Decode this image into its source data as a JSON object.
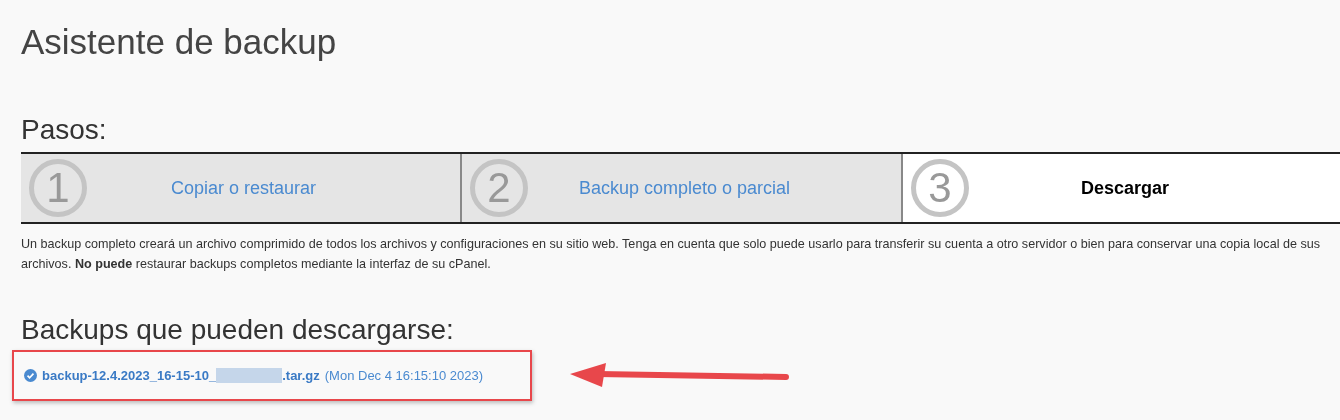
{
  "title": "Asistente de backup",
  "steps_heading": "Pasos:",
  "steps": [
    {
      "number": "1",
      "label": "Copiar o restaurar",
      "selected": false
    },
    {
      "number": "2",
      "label": "Backup completo o parcial",
      "selected": false
    },
    {
      "number": "3",
      "label": "Descargar",
      "selected": true
    }
  ],
  "description": "Un backup completo creará un archivo comprimido de todos los archivos y configuraciones en su sitio web. Tenga en cuenta que solo puede usarlo para transferir su cuenta a otro servidor o bien para conservar una copia local de sus archivos. **No puede** restaurar backups completos mediante la interfaz de su cPanel.",
  "backups_heading": "Backups que pueden descargarse:",
  "backups": [
    {
      "file_start": "backup-12.4.2023_16-15-10_",
      "file_end": ".tar.gz",
      "date": "(Mon Dec 4 16:15:10 2023)"
    }
  ]
}
